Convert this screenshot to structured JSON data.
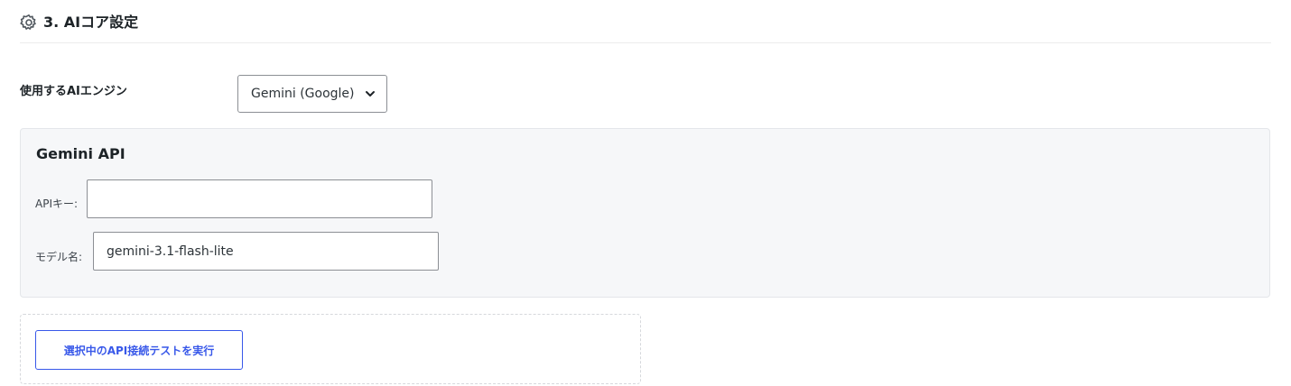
{
  "section": {
    "icon": "gear-icon",
    "title": "3. AIコア設定"
  },
  "engine": {
    "label": "使用するAIエンジン",
    "selected": "Gemini (Google)",
    "dropdown_icon": "chevron-down-icon"
  },
  "gemini_panel": {
    "title": "Gemini API",
    "api_key_label": "APIキー:",
    "api_key_value": "",
    "model_label": "モデル名:",
    "model_value": "gemini-3.1-flash-lite"
  },
  "test": {
    "button_label": "選択中のAPI接続テストを実行"
  },
  "colors": {
    "accent": "#3858e9",
    "panel_bg": "#f6f7f9",
    "text": "#1d2327"
  }
}
